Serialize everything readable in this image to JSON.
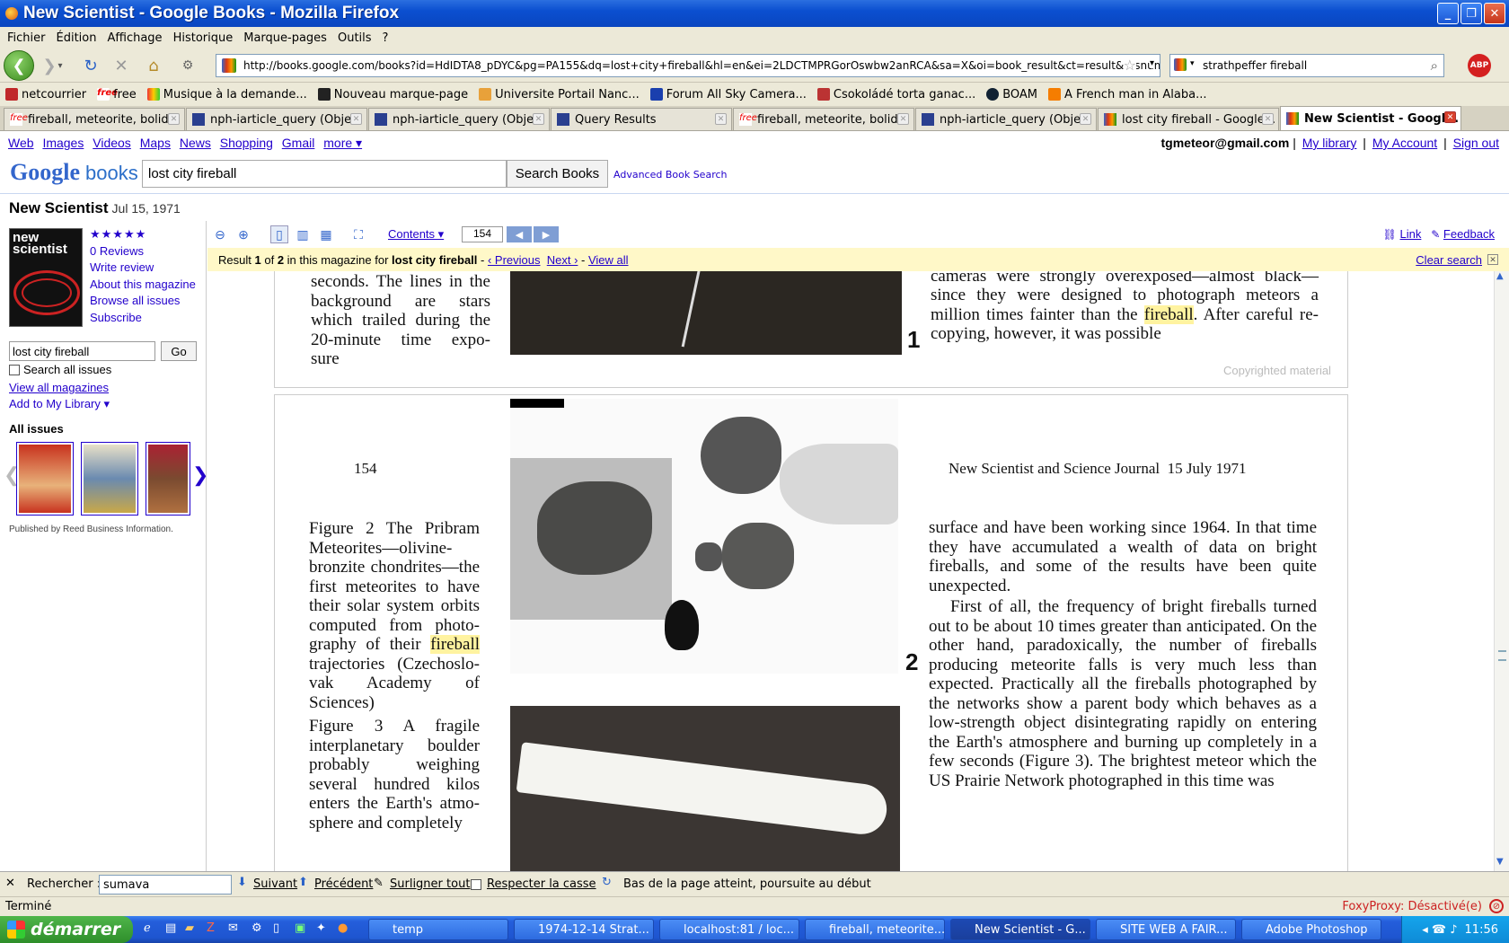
{
  "window": {
    "title": "New Scientist - Google Books - Mozilla Firefox"
  },
  "menu": [
    "Fichier",
    "Édition",
    "Affichage",
    "Historique",
    "Marque-pages",
    "Outils",
    "?"
  ],
  "nav": {
    "url": "http://books.google.com/books?id=HdIDTA8_pDYC&pg=PA155&dq=lost+city+fireball&hl=en&ei=2LDCTMPRGorOswbw2anRCA&sa=X&oi=book_result&ct=result&resnum=9",
    "search": "strathpeffer fireball",
    "abp": "ABP"
  },
  "bookmarks": [
    "netcourrier",
    "free",
    "Musique à la demande...",
    "Nouveau marque-page",
    "Universite Portail Nanc...",
    "Forum All Sky Camera...",
    "Csokoládé torta ganac...",
    "BOAM",
    "A French man in Alaba..."
  ],
  "tabs": [
    {
      "label": "fireball, meteorite, bolid...",
      "icon": "free"
    },
    {
      "label": "nph-iarticle_query (Obje...",
      "icon": "ads"
    },
    {
      "label": "nph-iarticle_query (Obje...",
      "icon": "ads"
    },
    {
      "label": "Query Results",
      "icon": "ads"
    },
    {
      "label": "fireball, meteorite, bolid...",
      "icon": "free"
    },
    {
      "label": "nph-iarticle_query (Obje...",
      "icon": "ads"
    },
    {
      "label": "lost city fireball - Google...",
      "icon": "g"
    },
    {
      "label": "New Scientist - Googl...",
      "icon": "g",
      "active": true
    }
  ],
  "gbar": {
    "links": [
      "Web",
      "Images",
      "Videos",
      "Maps",
      "News",
      "Shopping",
      "Gmail",
      "more ▾"
    ],
    "email": "tgmeteor@gmail.com",
    "right_links": [
      "My library",
      "My Account",
      "Sign out"
    ]
  },
  "header": {
    "logo": "Google",
    "logo_sub": "books",
    "query": "lost city fireball",
    "search_btn": "Search Books",
    "advanced": "Advanced Book Search"
  },
  "book": {
    "title": "New Scientist",
    "date": "Jul 15, 1971"
  },
  "sidebar": {
    "stars": "★★★★★",
    "links": [
      "0 Reviews",
      "Write review",
      "About this magazine",
      "Browse all issues",
      "Subscribe"
    ],
    "search_value": "lost city fireball",
    "go": "Go",
    "search_all": "Search all issues",
    "view_all": "View all magazines",
    "add_library": "Add to My Library ▾",
    "all_issues": "All issues",
    "published_by": "Published by Reed Business Information.",
    "cover_text": "new scientist"
  },
  "viewer": {
    "contents": "Contents ▾",
    "page": "154",
    "link": "Link",
    "feedback": "Feedback",
    "result": {
      "prefix": "Result",
      "n": "1",
      "of": "of",
      "total": "2",
      "mid": "in this magazine for",
      "query": "lost city fireball",
      "prev": "‹ Previous",
      "next": "Next ›",
      "viewall": "View all",
      "clear": "Clear search"
    }
  },
  "page1": {
    "caption": "seconds. The lines in the background are stars which trailed during the 20-minute time expo- sure",
    "text_pre": "only half a mile from Ondrejov. The plates in the cameras were strongly overexposed—almost black—since they were designed to photograph meteors a million times fainter than the",
    "hl": "fireball",
    "text_post": ". After careful re-copying, however, it was possible",
    "marker": "1",
    "copyright": "Copyrighted material"
  },
  "page2": {
    "page_no": "154",
    "running_head": "New Scientist and Science Journal  15 July 1971",
    "fig2_pre": "Figure 2   The Pribram Meteorites—olivine-bronzite chondrites—the first meteorites to have their solar system orbits computed from photo- graphy of their",
    "fig2_hl": "fireball",
    "fig2_post": "trajectories (Czechoslo- vak Academy of Sciences)",
    "fig3": "Figure 3   A fragile interplanetary boulder probably weighing several hundred kilos enters the Earth's atmo- sphere and completely",
    "body1": "surface and have been working since 1964. In that time they have accumulated a wealth of data on bright fireballs, and some of the results have been quite unexpected.",
    "body2": "First of all, the frequency of bright fireballs turned out to be about 10 times greater than anticipated. On the other hand, paradoxically, the number of fireballs producing meteorite falls is very much less than expected. Practically all the fireballs photographed by the networks show a parent body which behaves as a low-strength object disintegrating rapidly on entering the Earth's atmosphere and burning up completely in a few seconds (Figure 3). The brightest meteor which the US Prairie Network photographed in this time was",
    "marker": "2"
  },
  "findbar": {
    "label": "Rechercher :",
    "value": "sumava",
    "next": "Suivant",
    "prev": "Précédent",
    "highlight": "Surligner tout",
    "matchcase": "Respecter la casse",
    "status": "Bas de la page atteint, poursuite au début"
  },
  "status": {
    "text": "Terminé",
    "foxy": "FoxyProxy: Désactivé(e)"
  },
  "taskbar": {
    "start": "démarrer",
    "items": [
      "temp",
      "1974-12-14 Strat...",
      "localhost:81 / loc...",
      "fireball, meteorite...",
      "New Scientist - G...",
      "SITE WEB A FAIR...",
      "Adobe Photoshop"
    ],
    "clock": "11:56"
  }
}
